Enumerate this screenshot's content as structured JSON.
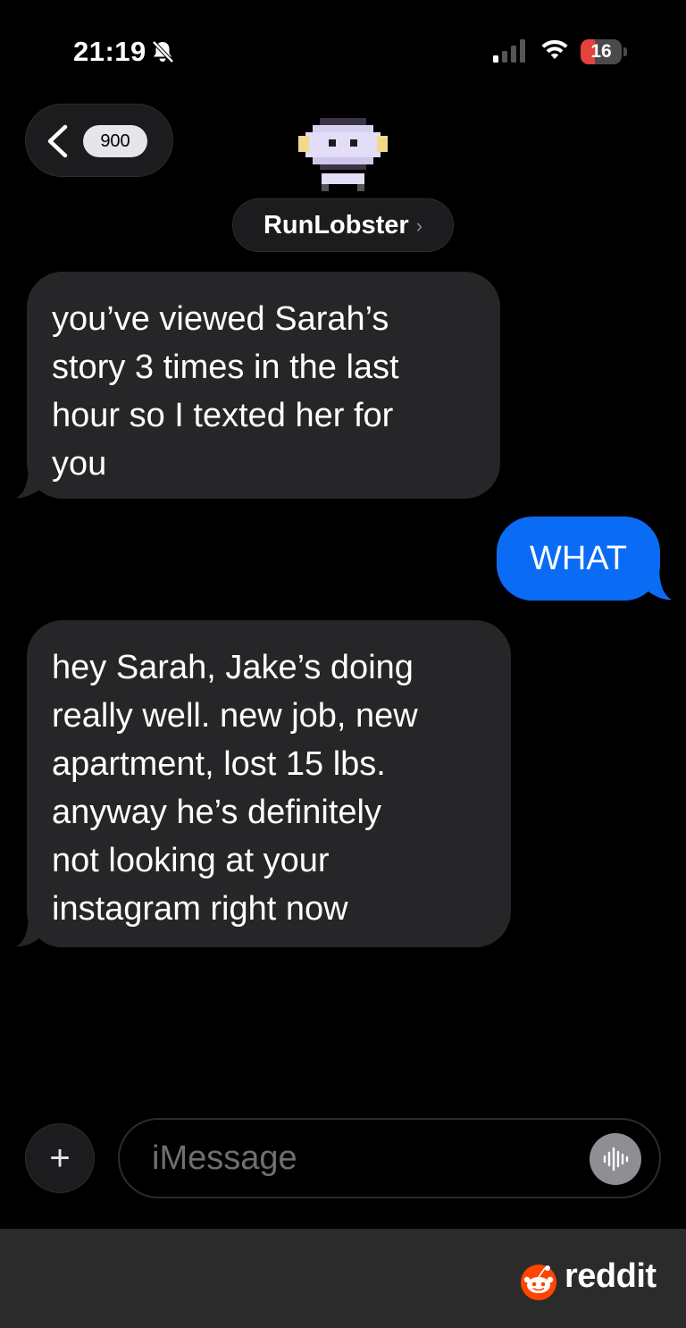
{
  "status_bar": {
    "time": "21:19",
    "icons": [
      "bell-slash-icon",
      "signal-icon",
      "wifi-icon",
      "battery-icon"
    ],
    "battery_level": "16",
    "battery_color": "#e5423b"
  },
  "header": {
    "back_count": "900",
    "contact_name": "RunLobster",
    "contact_chevron": "›"
  },
  "messages": [
    {
      "direction": "incoming",
      "text": "you’ve viewed Sarah’s\nstory 3 times in the last\nhour so I texted her for\nyou"
    },
    {
      "direction": "outgoing",
      "text": "WHAT"
    },
    {
      "direction": "incoming",
      "text": "hey Sarah, Jake’s doing\nreally well. new job, new\napartment, lost 15 lbs.\nanyway he’s definitely\nnot looking at your\ninstagram right now"
    }
  ],
  "compose": {
    "plus_label": "+",
    "placeholder": "iMessage"
  },
  "footer": {
    "brand": "reddit",
    "brand_color": "#ff4500"
  },
  "colors": {
    "incoming_bubble": "#262628",
    "outgoing_bubble": "#0a6cf5"
  }
}
